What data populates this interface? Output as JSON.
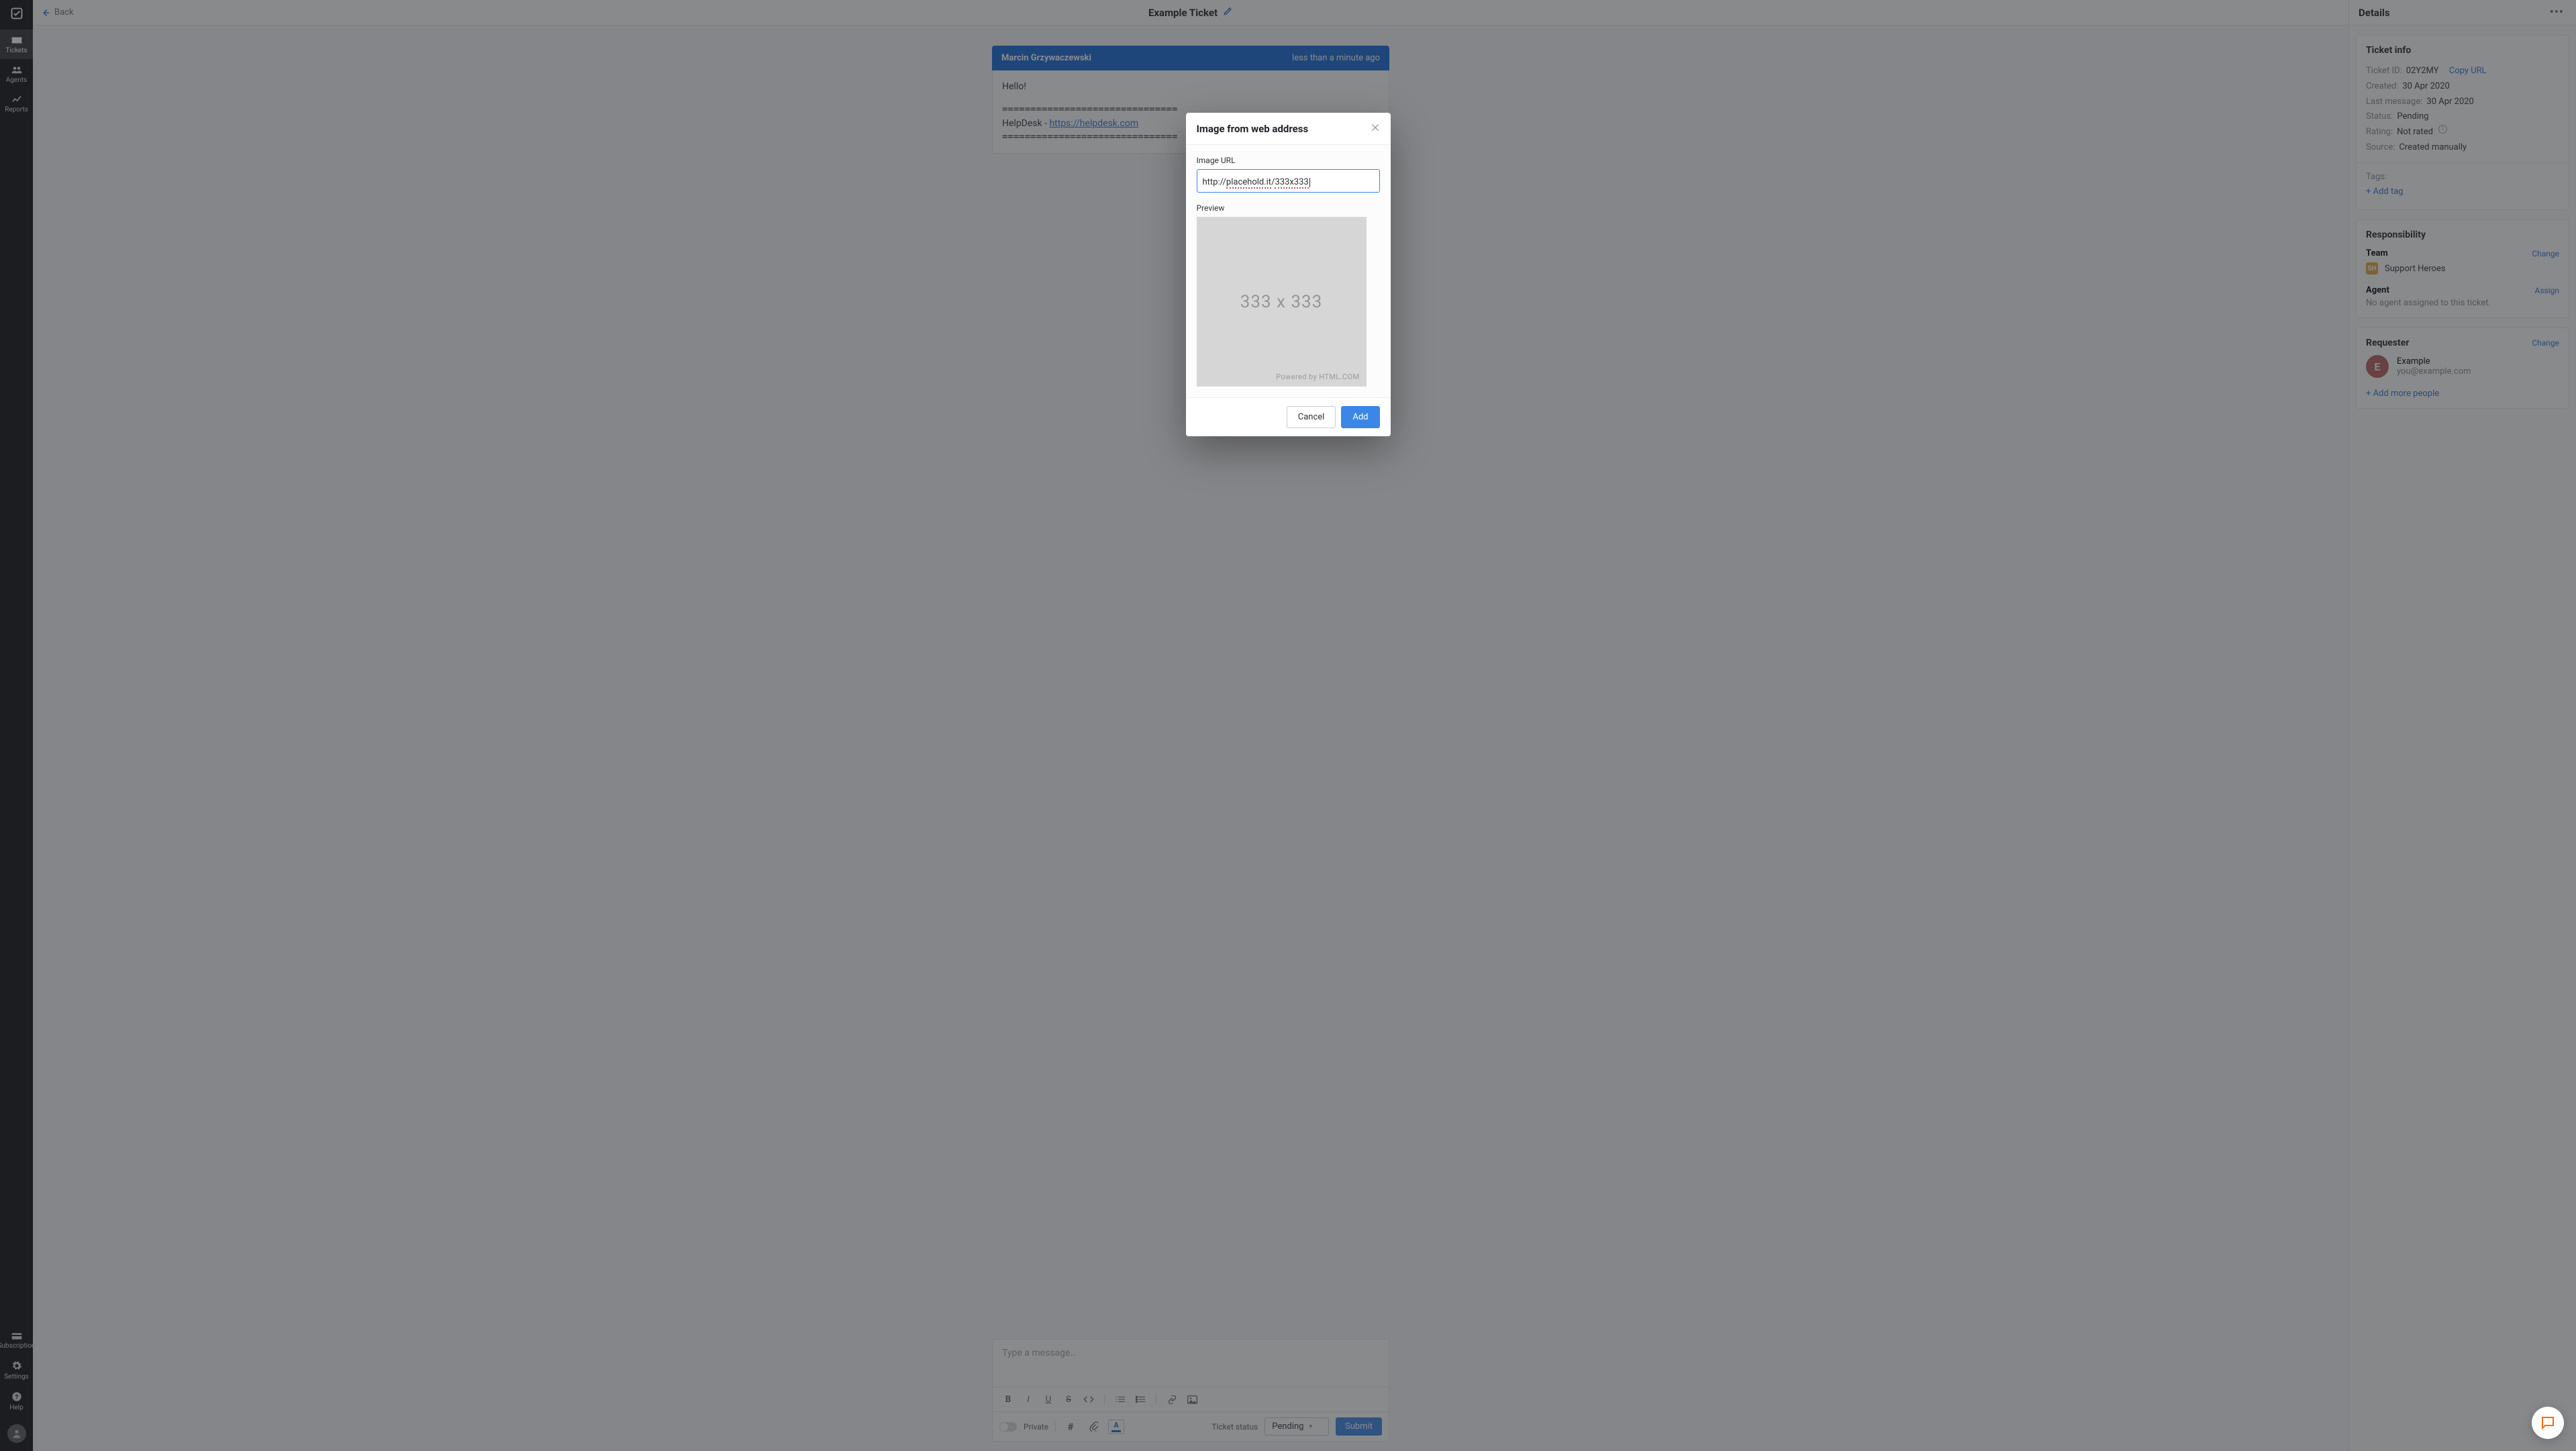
{
  "sidenav": {
    "items": [
      {
        "label": "Tickets"
      },
      {
        "label": "Agents"
      },
      {
        "label": "Reports"
      }
    ],
    "bottom": [
      {
        "label": "Subscription"
      },
      {
        "label": "Settings"
      },
      {
        "label": "Help"
      }
    ]
  },
  "topbar": {
    "back": "Back",
    "title": "Example Ticket"
  },
  "message": {
    "author": "Marcin Grzywaczewski",
    "timestamp": "less than a minute ago",
    "greeting": "Hello!",
    "separator": "===============================",
    "sig_prefix": "HelpDesk - ",
    "sig_link": "https://helpdesk.com"
  },
  "composer": {
    "placeholder": "Type a message…",
    "private": "Private",
    "status_label": "Ticket status",
    "status_value": "Pending",
    "submit": "Submit"
  },
  "details": {
    "header": "Details",
    "ticket_info": {
      "heading": "Ticket info",
      "id_label": "Ticket ID:",
      "id_value": "02Y2MY",
      "copy": "Copy URL",
      "created_label": "Created:",
      "created_value": "30 Apr 2020",
      "last_label": "Last message:",
      "last_value": "30 Apr 2020",
      "status_label": "Status:",
      "status_value": "Pending",
      "rating_label": "Rating:",
      "rating_value": "Not rated",
      "source_label": "Source:",
      "source_value": "Created manually",
      "tags_label": "Tags:",
      "add_tag": "+ Add tag"
    },
    "responsibility": {
      "heading": "Responsibility",
      "team_label": "Team",
      "team_change": "Change",
      "team_name": "Support Heroes",
      "agent_label": "Agent",
      "agent_assign": "Assign",
      "agent_none": "No agent assigned to this ticket."
    },
    "requester": {
      "heading": "Requester",
      "change": "Change",
      "initial": "E",
      "name": "Example",
      "email": "you@example.com",
      "add_more": "+ Add more people"
    }
  },
  "modal": {
    "title": "Image from web address",
    "url_label": "Image URL",
    "url_plain_1": "http://",
    "url_squig_1": "placehold.it",
    "url_plain_2": "/",
    "url_squig_2": "333x333",
    "preview_label": "Preview",
    "preview_text": "333 x 333",
    "preview_caption": "Powered by HTML.COM",
    "cancel": "Cancel",
    "add": "Add"
  }
}
